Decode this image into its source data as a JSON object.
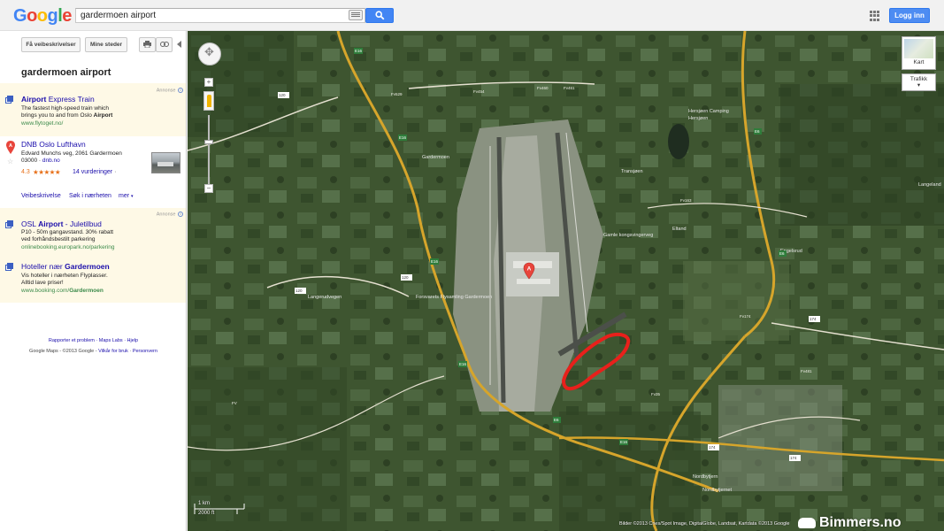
{
  "header": {
    "logo": "Google",
    "logo_colors": [
      "#4285f4",
      "#ea4335",
      "#fbbc05",
      "#4285f4",
      "#34a853",
      "#ea4335"
    ],
    "search_value": "gardermoen airport",
    "search_icon": "search-icon",
    "apps_icon": "apps-grid-icon",
    "login_label": "Logg inn",
    "accent_color": "#4285f4"
  },
  "panel": {
    "buttons": {
      "directions": "Få veibeskrivelser",
      "my_places": "Mine steder",
      "print_icon": "print-icon",
      "link_icon": "link-icon"
    },
    "query_title": "gardermoen airport",
    "ad_label": "Annonse",
    "results": [
      {
        "title_pre": "Airport",
        "title_post": " Express Train",
        "line1": "The fastest high-speed train which",
        "line2_pre": "brings you to and from Oslo ",
        "line2_bold": "Airport",
        "url": "www.flytoget.no/"
      },
      {
        "title": "DNB Oslo Lufthavn",
        "pin_label": "A",
        "line1": "Edvard Munchs veg, 2061 Gardermoen",
        "line2": "03000 · ",
        "line2_link": "dnb.no",
        "rating": "4.3",
        "stars": "★★★★★",
        "reviews": "14 vurderinger",
        "reviews_suffix": " ·",
        "actions": [
          "Veibeskrivelse",
          "Søk i nærheten",
          "mer"
        ]
      },
      {
        "title_pre": "OSL ",
        "title_bold": "Airport",
        "title_post": " - Juletilbud",
        "line1": "P10 - 50m gangavstand. 30% rabatt",
        "line2": "ved forhåndsbestilt parkering",
        "url": "onlinebooking.europark.no/parkering"
      },
      {
        "title_pre": "Hoteller nær ",
        "title_bold": "Gardermoen",
        "line1": "Vis hoteller i nærheten Flyplasser.",
        "line2": "Alltid lave priser!",
        "url_pre": "www.booking.com/",
        "url_bold": "Gardermoen"
      }
    ],
    "footer": {
      "links": "Rapporter et problem · Maps Labs · Hjelp",
      "copyright": "Google Maps - ©2013 Google - ",
      "terms_link": "Vilkår for bruk",
      "privacy_link": "Personvern"
    }
  },
  "map": {
    "mode_label": "Kart",
    "traffic_label": "Trafikk",
    "scale_km": "1 km",
    "scale_ft": "2000 ft",
    "attribution": "Bilder ©2013 Cnes/Spot Image, DigitalGlobe, Landsat, Kartdata ©2013 Google",
    "watermark": "Bimmers.no",
    "marker_label": "A",
    "labels": [
      "Gardermoen",
      "Forsvarets Flysamling Gardermoen",
      "Hersjøen Camping",
      "Hersjøen",
      "Nordbytjern",
      "Nordbytjernet",
      "Transjøen",
      "Eltand",
      "Langeland",
      "Engelsrud",
      "Langerudvegen",
      "Gamle kongsvingerveg"
    ],
    "road_shields": [
      "E16",
      "E6",
      "120",
      "174",
      "FV",
      "Fv529",
      "Fv454",
      "Fv460",
      "Fv461",
      "Fv163",
      "Fv174",
      "Fv481",
      "Fv35"
    ],
    "highlight_color": "#e8201b"
  }
}
